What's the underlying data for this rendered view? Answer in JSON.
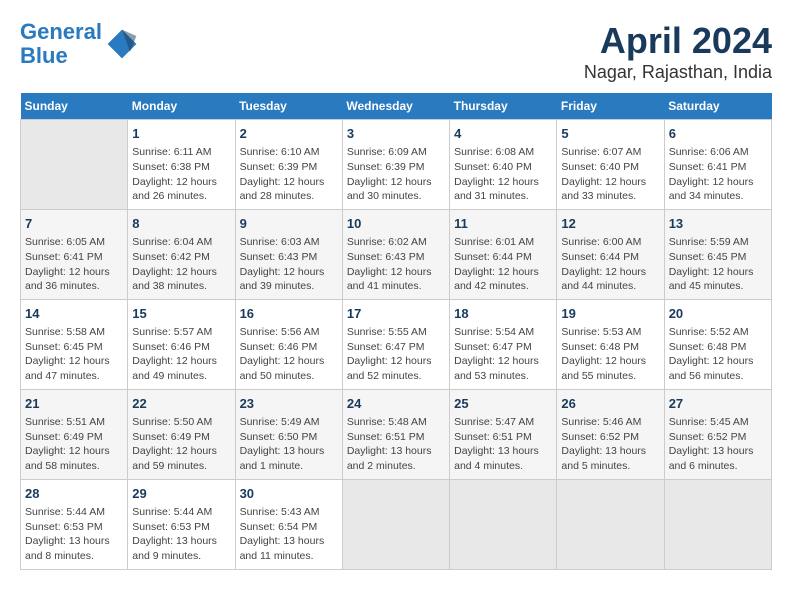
{
  "header": {
    "logo_line1": "General",
    "logo_line2": "Blue",
    "title": "April 2024",
    "subtitle": "Nagar, Rajasthan, India"
  },
  "days_of_week": [
    "Sunday",
    "Monday",
    "Tuesday",
    "Wednesday",
    "Thursday",
    "Friday",
    "Saturday"
  ],
  "weeks": [
    [
      {
        "day": "",
        "info": ""
      },
      {
        "day": "1",
        "info": "Sunrise: 6:11 AM\nSunset: 6:38 PM\nDaylight: 12 hours\nand 26 minutes."
      },
      {
        "day": "2",
        "info": "Sunrise: 6:10 AM\nSunset: 6:39 PM\nDaylight: 12 hours\nand 28 minutes."
      },
      {
        "day": "3",
        "info": "Sunrise: 6:09 AM\nSunset: 6:39 PM\nDaylight: 12 hours\nand 30 minutes."
      },
      {
        "day": "4",
        "info": "Sunrise: 6:08 AM\nSunset: 6:40 PM\nDaylight: 12 hours\nand 31 minutes."
      },
      {
        "day": "5",
        "info": "Sunrise: 6:07 AM\nSunset: 6:40 PM\nDaylight: 12 hours\nand 33 minutes."
      },
      {
        "day": "6",
        "info": "Sunrise: 6:06 AM\nSunset: 6:41 PM\nDaylight: 12 hours\nand 34 minutes."
      }
    ],
    [
      {
        "day": "7",
        "info": "Sunrise: 6:05 AM\nSunset: 6:41 PM\nDaylight: 12 hours\nand 36 minutes."
      },
      {
        "day": "8",
        "info": "Sunrise: 6:04 AM\nSunset: 6:42 PM\nDaylight: 12 hours\nand 38 minutes."
      },
      {
        "day": "9",
        "info": "Sunrise: 6:03 AM\nSunset: 6:43 PM\nDaylight: 12 hours\nand 39 minutes."
      },
      {
        "day": "10",
        "info": "Sunrise: 6:02 AM\nSunset: 6:43 PM\nDaylight: 12 hours\nand 41 minutes."
      },
      {
        "day": "11",
        "info": "Sunrise: 6:01 AM\nSunset: 6:44 PM\nDaylight: 12 hours\nand 42 minutes."
      },
      {
        "day": "12",
        "info": "Sunrise: 6:00 AM\nSunset: 6:44 PM\nDaylight: 12 hours\nand 44 minutes."
      },
      {
        "day": "13",
        "info": "Sunrise: 5:59 AM\nSunset: 6:45 PM\nDaylight: 12 hours\nand 45 minutes."
      }
    ],
    [
      {
        "day": "14",
        "info": "Sunrise: 5:58 AM\nSunset: 6:45 PM\nDaylight: 12 hours\nand 47 minutes."
      },
      {
        "day": "15",
        "info": "Sunrise: 5:57 AM\nSunset: 6:46 PM\nDaylight: 12 hours\nand 49 minutes."
      },
      {
        "day": "16",
        "info": "Sunrise: 5:56 AM\nSunset: 6:46 PM\nDaylight: 12 hours\nand 50 minutes."
      },
      {
        "day": "17",
        "info": "Sunrise: 5:55 AM\nSunset: 6:47 PM\nDaylight: 12 hours\nand 52 minutes."
      },
      {
        "day": "18",
        "info": "Sunrise: 5:54 AM\nSunset: 6:47 PM\nDaylight: 12 hours\nand 53 minutes."
      },
      {
        "day": "19",
        "info": "Sunrise: 5:53 AM\nSunset: 6:48 PM\nDaylight: 12 hours\nand 55 minutes."
      },
      {
        "day": "20",
        "info": "Sunrise: 5:52 AM\nSunset: 6:48 PM\nDaylight: 12 hours\nand 56 minutes."
      }
    ],
    [
      {
        "day": "21",
        "info": "Sunrise: 5:51 AM\nSunset: 6:49 PM\nDaylight: 12 hours\nand 58 minutes."
      },
      {
        "day": "22",
        "info": "Sunrise: 5:50 AM\nSunset: 6:49 PM\nDaylight: 12 hours\nand 59 minutes."
      },
      {
        "day": "23",
        "info": "Sunrise: 5:49 AM\nSunset: 6:50 PM\nDaylight: 13 hours\nand 1 minute."
      },
      {
        "day": "24",
        "info": "Sunrise: 5:48 AM\nSunset: 6:51 PM\nDaylight: 13 hours\nand 2 minutes."
      },
      {
        "day": "25",
        "info": "Sunrise: 5:47 AM\nSunset: 6:51 PM\nDaylight: 13 hours\nand 4 minutes."
      },
      {
        "day": "26",
        "info": "Sunrise: 5:46 AM\nSunset: 6:52 PM\nDaylight: 13 hours\nand 5 minutes."
      },
      {
        "day": "27",
        "info": "Sunrise: 5:45 AM\nSunset: 6:52 PM\nDaylight: 13 hours\nand 6 minutes."
      }
    ],
    [
      {
        "day": "28",
        "info": "Sunrise: 5:44 AM\nSunset: 6:53 PM\nDaylight: 13 hours\nand 8 minutes."
      },
      {
        "day": "29",
        "info": "Sunrise: 5:44 AM\nSunset: 6:53 PM\nDaylight: 13 hours\nand 9 minutes."
      },
      {
        "day": "30",
        "info": "Sunrise: 5:43 AM\nSunset: 6:54 PM\nDaylight: 13 hours\nand 11 minutes."
      },
      {
        "day": "",
        "info": ""
      },
      {
        "day": "",
        "info": ""
      },
      {
        "day": "",
        "info": ""
      },
      {
        "day": "",
        "info": ""
      }
    ]
  ]
}
